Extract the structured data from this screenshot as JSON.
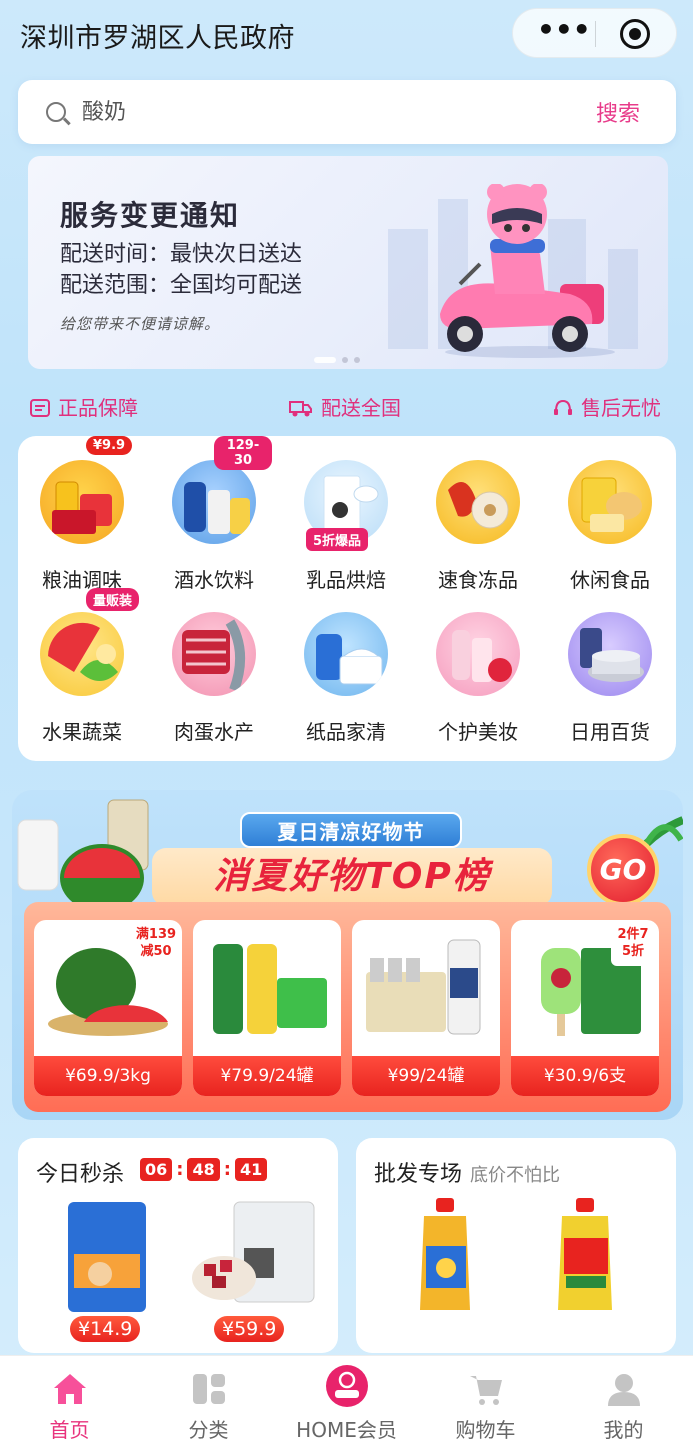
{
  "header": {
    "title": "深圳市罗湖区人民政府"
  },
  "search": {
    "placeholder": "酸奶",
    "button_label": "搜索"
  },
  "banner": {
    "title": "服务变更通知",
    "line1": "配送时间：最快次日送达",
    "line2": "配送范围：全国均可配送",
    "note": "给您带来不便请谅解。"
  },
  "guarantees": [
    {
      "label": "正品保障",
      "icon": "certificate-icon"
    },
    {
      "label": "配送全国",
      "icon": "truck-icon"
    },
    {
      "label": "售后无忧",
      "icon": "headset-icon"
    }
  ],
  "categories": [
    {
      "label": "粮油调味",
      "tag": "¥9.9"
    },
    {
      "label": "酒水饮料",
      "tag": "129-30"
    },
    {
      "label": "乳品烘焙",
      "tag": "5折爆品"
    },
    {
      "label": "速食冻品",
      "tag": ""
    },
    {
      "label": "休闲食品",
      "tag": ""
    },
    {
      "label": "水果蔬菜",
      "tag": "量贩装"
    },
    {
      "label": "肉蛋水产",
      "tag": ""
    },
    {
      "label": "纸品家清",
      "tag": ""
    },
    {
      "label": "个护美妆",
      "tag": ""
    },
    {
      "label": "日用百货",
      "tag": ""
    }
  ],
  "promo": {
    "ribbon": "夏日清凉好物节",
    "headline": "消夏好物TOP榜",
    "go": "GO",
    "products": [
      {
        "price": "¥69.9/3kg",
        "tag": "满139减50"
      },
      {
        "price": "¥79.9/24罐",
        "tag": ""
      },
      {
        "price": "¥99/24罐",
        "tag": ""
      },
      {
        "price": "¥30.9/6支",
        "tag": "2件75折"
      }
    ]
  },
  "flash_sale": {
    "title": "今日秒杀",
    "timer": [
      "06",
      "48",
      "41"
    ],
    "items": [
      {
        "price": "¥14.9"
      },
      {
        "price": "¥59.9"
      }
    ]
  },
  "wholesale": {
    "title": "批发专场",
    "subtitle": "底价不怕比"
  },
  "tabbar": [
    {
      "label": "首页",
      "icon": "home-icon",
      "active": true
    },
    {
      "label": "分类",
      "icon": "grid-icon",
      "active": false
    },
    {
      "label": "HOME会员",
      "icon": "member-logo-icon",
      "active": false
    },
    {
      "label": "购物车",
      "icon": "cart-icon",
      "active": false
    },
    {
      "label": "我的",
      "icon": "profile-icon",
      "active": false
    }
  ],
  "colors": {
    "accent": "#e8337d",
    "price_red": "#e8231f",
    "bg": "#c6e6fb"
  }
}
